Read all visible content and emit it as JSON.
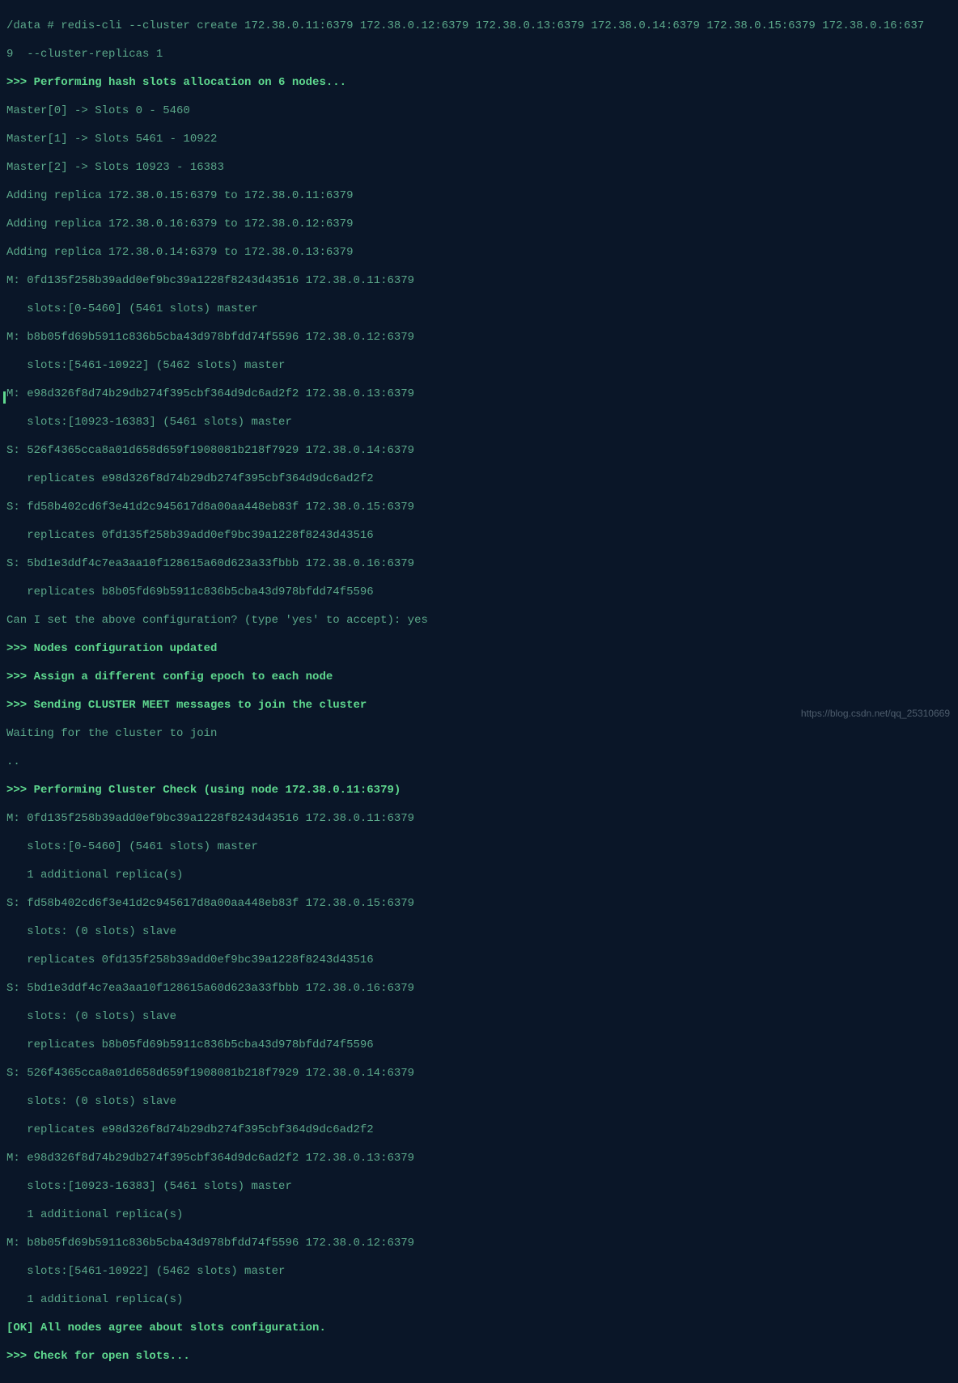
{
  "cmd": "/data # redis-cli --cluster create 172.38.0.11:6379 172.38.0.12:6379 172.38.0.13:6379 172.38.0.14:6379 172.38.0.15:6379 172.38.0.16:637",
  "cmd2": "9  --cluster-replicas 1",
  "h1": ">>> Performing hash slots allocation on 6 nodes...",
  "m0": "Master[0] -> Slots 0 - 5460",
  "m1": "Master[1] -> Slots 5461 - 10922",
  "m2": "Master[2] -> Slots 10923 - 16383",
  "r1": "Adding replica 172.38.0.15:6379 to 172.38.0.11:6379",
  "r2": "Adding replica 172.38.0.16:6379 to 172.38.0.12:6379",
  "r3": "Adding replica 172.38.0.14:6379 to 172.38.0.13:6379",
  "n1a": "M: 0fd135f258b39add0ef9bc39a1228f8243d43516 172.38.0.11:6379",
  "n1b": "   slots:[0-5460] (5461 slots) master",
  "n2a": "M: b8b05fd69b5911c836b5cba43d978bfdd74f5596 172.38.0.12:6379",
  "n2b": "   slots:[5461-10922] (5462 slots) master",
  "n3a": "M: e98d326f8d74b29db274f395cbf364d9dc6ad2f2 172.38.0.13:6379",
  "n3b": "   slots:[10923-16383] (5461 slots) master",
  "n4a": "S: 526f4365cca8a01d658d659f1908081b218f7929 172.38.0.14:6379",
  "n4b": "   replicates e98d326f8d74b29db274f395cbf364d9dc6ad2f2",
  "n5a": "S: fd58b402cd6f3e41d2c945617d8a00aa448eb83f 172.38.0.15:6379",
  "n5b": "   replicates 0fd135f258b39add0ef9bc39a1228f8243d43516",
  "n6a": "S: 5bd1e3ddf4c7ea3aa10f128615a60d623a33fbbb 172.38.0.16:6379",
  "n6b": "   replicates b8b05fd69b5911c836b5cba43d978bfdd74f5596",
  "confirm": "Can I set the above configuration? (type 'yes' to accept): yes",
  "h2": ">>> Nodes configuration updated",
  "h3": ">>> Assign a different config epoch to each node",
  "h4": ">>> Sending CLUSTER MEET messages to join the cluster",
  "wait": "Waiting for the cluster to join",
  "dots": "..",
  "h5": ">>> Performing Cluster Check (using node 172.38.0.11:6379)",
  "c1a": "M: 0fd135f258b39add0ef9bc39a1228f8243d43516 172.38.0.11:6379",
  "c1b": "   slots:[0-5460] (5461 slots) master",
  "c1c": "   1 additional replica(s)",
  "c2a": "S: fd58b402cd6f3e41d2c945617d8a00aa448eb83f 172.38.0.15:6379",
  "c2b": "   slots: (0 slots) slave",
  "c2c": "   replicates 0fd135f258b39add0ef9bc39a1228f8243d43516",
  "c3a": "S: 5bd1e3ddf4c7ea3aa10f128615a60d623a33fbbb 172.38.0.16:6379",
  "c3b": "   slots: (0 slots) slave",
  "c3c": "   replicates b8b05fd69b5911c836b5cba43d978bfdd74f5596",
  "c4a": "S: 526f4365cca8a01d658d659f1908081b218f7929 172.38.0.14:6379",
  "c4b": "   slots: (0 slots) slave",
  "c4c": "   replicates e98d326f8d74b29db274f395cbf364d9dc6ad2f2",
  "c5a": "M: e98d326f8d74b29db274f395cbf364d9dc6ad2f2 172.38.0.13:6379",
  "c5b": "   slots:[10923-16383] (5461 slots) master",
  "c5c": "   1 additional replica(s)",
  "c6a": "M: b8b05fd69b5911c836b5cba43d978bfdd74f5596 172.38.0.12:6379",
  "c6b": "   slots:[5461-10922] (5462 slots) master",
  "c6c": "   1 additional replica(s)",
  "ok": "[OK] All nodes agree about slots configuration.",
  "h6": ">>> Check for open slots...",
  "watermark": "https://blog.csdn.net/qq_25310669"
}
